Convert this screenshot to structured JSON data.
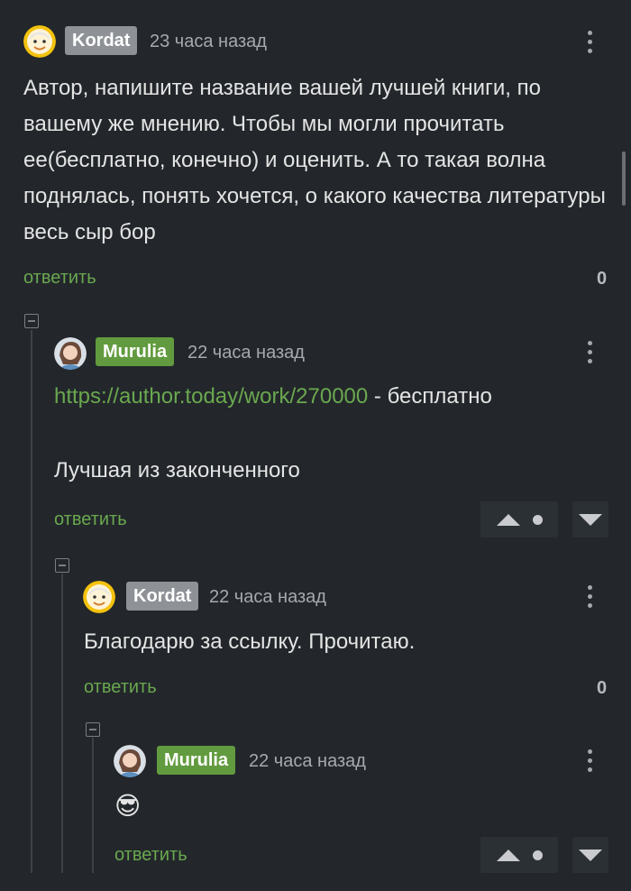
{
  "comments": [
    {
      "author": "Kordat",
      "time": "23 часа назад",
      "text": "Автор, напишите название вашей лучшей книги, по вашему же мнению. Чтобы мы могли прочитать ее(бесплатно, конечно) и оценить. А то такая волна поднялась, понять хочется, о какого качества литературы весь сыр бор",
      "reply_label": "ответить",
      "rating": "0"
    },
    {
      "author": "Murulia",
      "time": "22 часа назад",
      "link": "https://author.today/work/270000",
      "link_suffix": " - бесплатно",
      "text2": "Лучшая из законченного",
      "reply_label": "ответить"
    },
    {
      "author": "Kordat",
      "time": "22 часа назад",
      "text": "Благодарю за ссылку. Прочитаю.",
      "reply_label": "ответить",
      "rating": "0"
    },
    {
      "author": "Murulia",
      "time": "22 часа назад",
      "text": "😎",
      "reply_label": "ответить"
    }
  ],
  "icons": {
    "more": "more-vertical-icon",
    "collapse": "collapse-minus-icon",
    "vote_up": "vote-up-icon",
    "vote_down": "vote-down-icon"
  },
  "colors": {
    "background": "#23272b",
    "accent_green": "#6aa84f",
    "badge_green": "#629b3f",
    "badge_gray": "#8e9297"
  }
}
